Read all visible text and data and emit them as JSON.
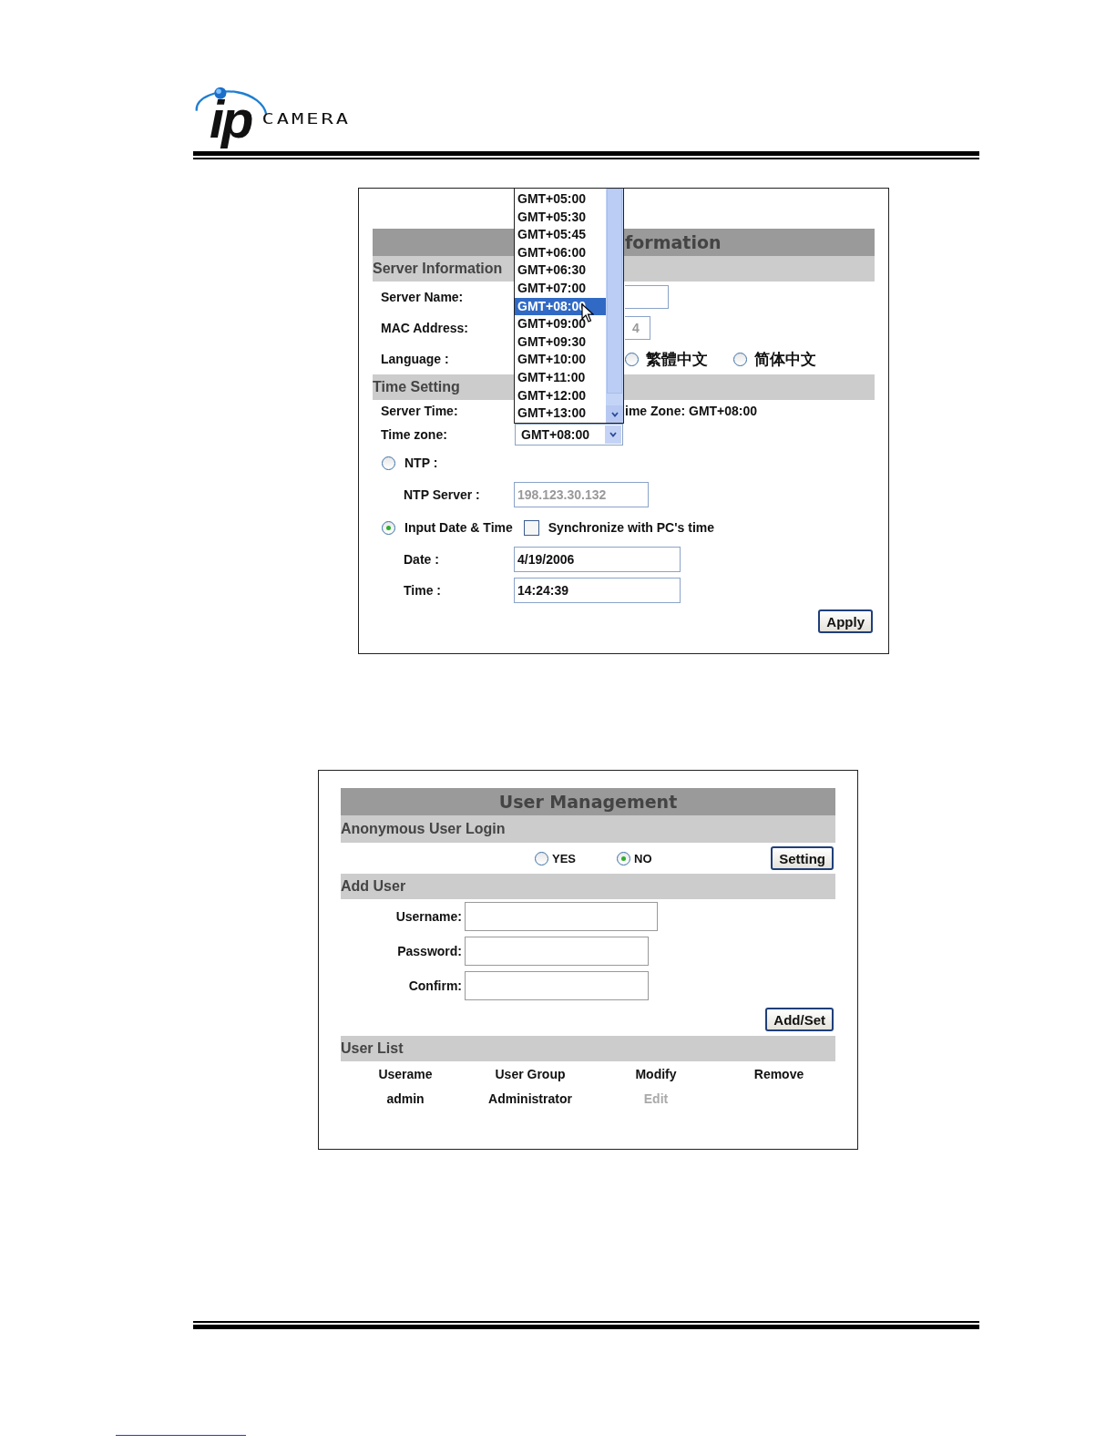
{
  "logo": {
    "mark": "ip",
    "name": "CAMERA"
  },
  "server_panel": {
    "header_visible": "formation",
    "server_section": "Server Information",
    "server_name": {
      "label": "Server Name:"
    },
    "mac_address": {
      "label": "MAC Address:",
      "value_visible": "4"
    },
    "language": {
      "label": "Language :",
      "options": [
        {
          "label": "繁體中文",
          "selected": false
        },
        {
          "label": "简体中文",
          "selected": false
        }
      ]
    },
    "time_section": "Time Setting",
    "server_time": {
      "label": "Server Time:",
      "value_visible": "ime Zone: GMT+08:00"
    },
    "time_zone": {
      "label": "Time zone:",
      "value": "GMT+08:00",
      "expanded": true,
      "options": [
        {
          "label": "GMT+05:00",
          "selected": false
        },
        {
          "label": "GMT+05:30",
          "selected": false
        },
        {
          "label": "GMT+05:45",
          "selected": false
        },
        {
          "label": "GMT+06:00",
          "selected": false
        },
        {
          "label": "GMT+06:30",
          "selected": false
        },
        {
          "label": "GMT+07:00",
          "selected": false
        },
        {
          "label": "GMT+08:00",
          "selected": true
        },
        {
          "label": "GMT+09:00",
          "selected": false
        },
        {
          "label": "GMT+09:30",
          "selected": false
        },
        {
          "label": "GMT+10:00",
          "selected": false
        },
        {
          "label": "GMT+11:00",
          "selected": false
        },
        {
          "label": "GMT+12:00",
          "selected": false
        },
        {
          "label": "GMT+13:00",
          "selected": false
        }
      ]
    },
    "time_source": [
      {
        "label": "NTP :",
        "selected": false
      },
      {
        "label": "Input Date & Time",
        "selected": true
      }
    ],
    "ntp_server": {
      "label": "NTP Server :",
      "value": "198.123.30.132",
      "disabled": true
    },
    "sync_pc": {
      "label": "Synchronize with PC's time",
      "checked": false
    },
    "date": {
      "label": "Date :",
      "value": "4/19/2006"
    },
    "time": {
      "label": "Time :",
      "value": "14:24:39"
    },
    "apply_button": "Apply"
  },
  "user_panel": {
    "title": "User Management",
    "anonymous_section": "Anonymous User Login",
    "anonymous_options": [
      {
        "label": "YES",
        "selected": false
      },
      {
        "label": "NO",
        "selected": true
      }
    ],
    "setting_button": "Setting",
    "add_section": "Add User",
    "fields": [
      {
        "label": "Username:"
      },
      {
        "label": "Password:"
      },
      {
        "label": "Confirm:"
      }
    ],
    "add_button": "Add/Set",
    "list_section": "User List",
    "table": {
      "columns": [
        "Userame",
        "User Group",
        "Modify",
        "Remove"
      ],
      "rows": [
        {
          "cells": [
            {
              "text": "admin",
              "disabled": false
            },
            {
              "text": "Administrator",
              "disabled": false
            },
            {
              "text": "Edit",
              "disabled": true
            }
          ]
        }
      ]
    }
  }
}
